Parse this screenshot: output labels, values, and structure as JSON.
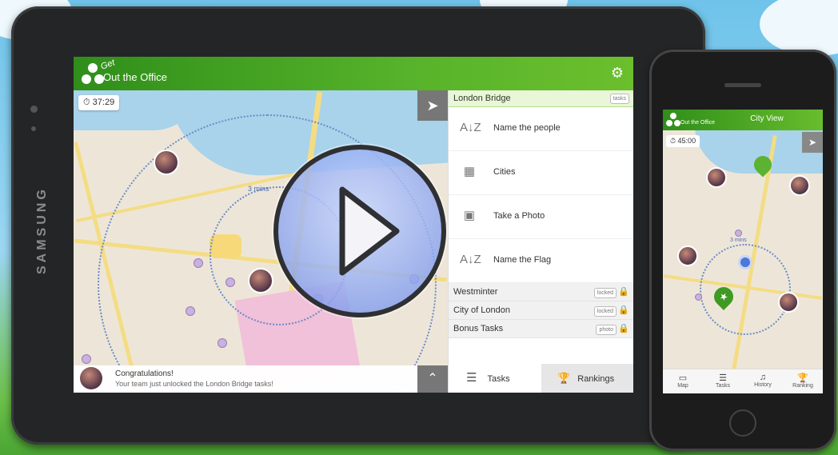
{
  "app": {
    "title": "Out the Office",
    "logo_word": "Get"
  },
  "tablet": {
    "brand": "SAMSUNG",
    "timer": "37:29",
    "notification": {
      "title": "Congratulations!",
      "body": "Your team just unlocked the London Bridge tasks!"
    },
    "panel": {
      "location": "London Bridge",
      "location_tag": "tasks",
      "tasks": [
        {
          "label": "Name the people",
          "icon": "az-sort-icon"
        },
        {
          "label": "Cities",
          "icon": "grid-icon"
        },
        {
          "label": "Take a Photo",
          "icon": "camera-icon"
        },
        {
          "label": "Name the Flag",
          "icon": "az-sort-icon"
        }
      ],
      "locked_locations": [
        {
          "label": "Westminter",
          "tag": "locked"
        },
        {
          "label": "City of London",
          "tag": "locked"
        },
        {
          "label": "Bonus Tasks",
          "tag": "photo"
        }
      ],
      "tabs": {
        "tasks": "Tasks",
        "rankings": "Rankings"
      }
    },
    "map_label": "3 mins"
  },
  "phone": {
    "title": "City View",
    "timer": "45:00",
    "map_label": "3 mins",
    "nav": [
      "Map",
      "Tasks",
      "History",
      "Ranking"
    ]
  },
  "colors": {
    "brand_green": "#57b32a",
    "panel_highlight": "#eaf6d9"
  }
}
